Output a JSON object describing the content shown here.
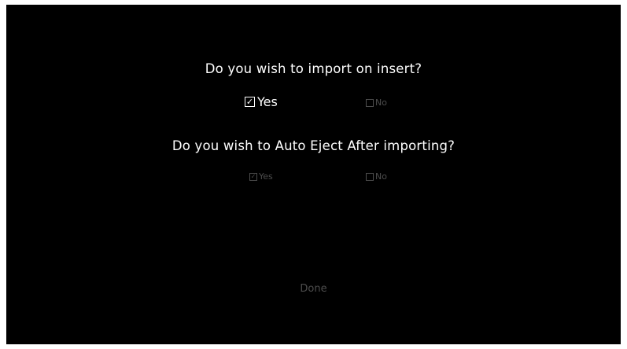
{
  "dialog": {
    "import_question": "Do you wish to import on insert?",
    "import_yes_label": "Yes",
    "import_yes_checked": true,
    "import_no_label": "No",
    "import_no_checked": false,
    "eject_question": "Do you wish to Auto Eject After importing?",
    "eject_yes_label": "Yes",
    "eject_yes_checked": true,
    "eject_no_label": "No",
    "eject_no_checked": false,
    "done_label": "Done",
    "check_mark": "✓"
  },
  "colors": {
    "background": "#000000",
    "text_primary": "#ffffff",
    "text_dim": "#4d4d4d"
  }
}
